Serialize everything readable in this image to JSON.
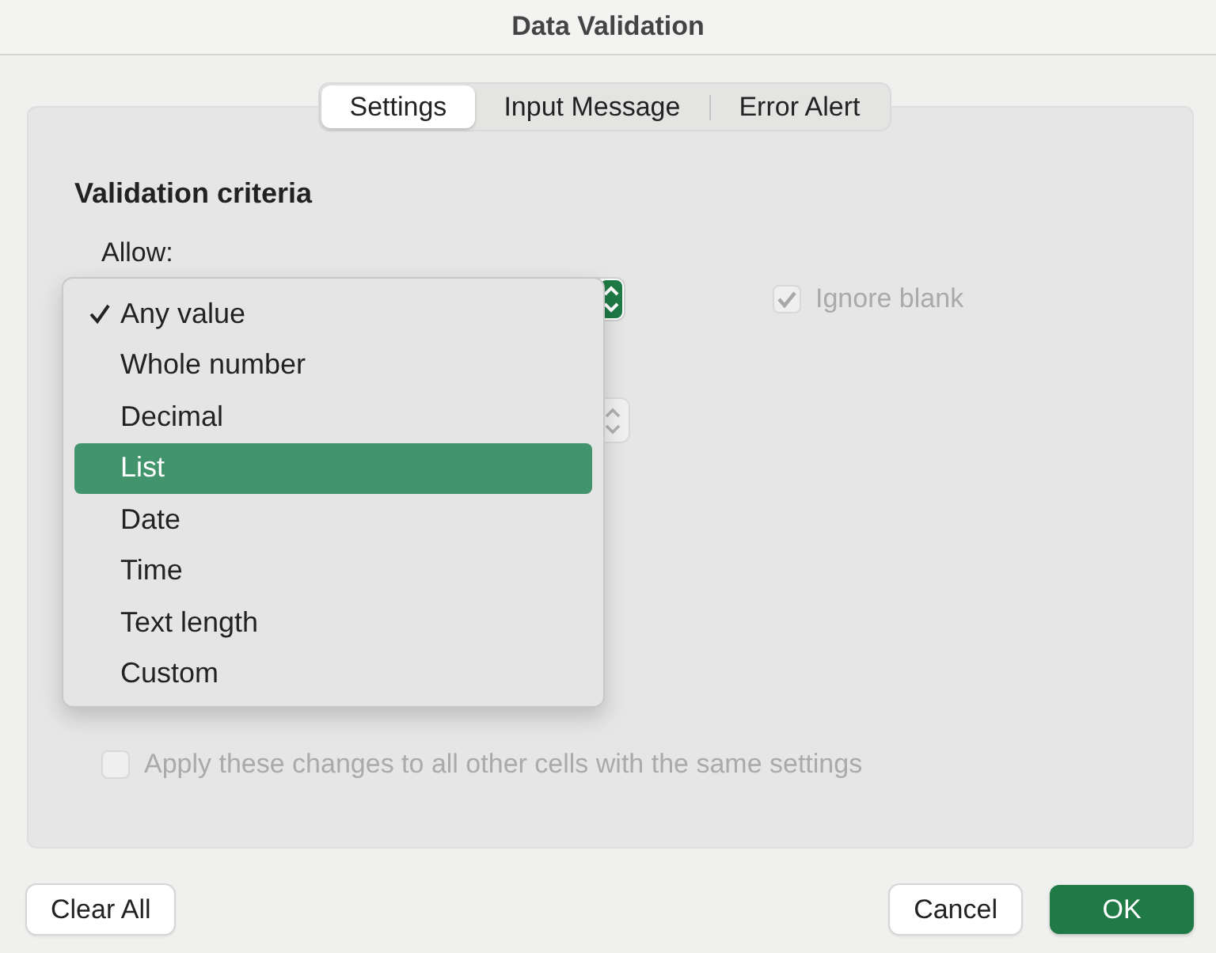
{
  "window": {
    "title": "Data Validation"
  },
  "tabs": [
    {
      "label": "Settings",
      "selected": true
    },
    {
      "label": "Input Message",
      "selected": false
    },
    {
      "label": "Error Alert",
      "selected": false
    }
  ],
  "section_title": "Validation criteria",
  "allow": {
    "label": "Allow:",
    "menu": [
      {
        "label": "Any value",
        "checked": true,
        "selected": false
      },
      {
        "label": "Whole number",
        "checked": false,
        "selected": false
      },
      {
        "label": "Decimal",
        "checked": false,
        "selected": false
      },
      {
        "label": "List",
        "checked": false,
        "selected": true
      },
      {
        "label": "Date",
        "checked": false,
        "selected": false
      },
      {
        "label": "Time",
        "checked": false,
        "selected": false
      },
      {
        "label": "Text length",
        "checked": false,
        "selected": false
      },
      {
        "label": "Custom",
        "checked": false,
        "selected": false
      }
    ]
  },
  "ignore_blank": {
    "label": "Ignore blank",
    "checked": true,
    "disabled": true
  },
  "apply_all": {
    "label": "Apply these changes to all other cells with the same settings",
    "checked": false,
    "disabled": true
  },
  "buttons": [
    {
      "label": "Clear All",
      "kind": "plain"
    },
    {
      "label": "Cancel",
      "kind": "plain"
    },
    {
      "label": "OK",
      "kind": "primary"
    }
  ]
}
